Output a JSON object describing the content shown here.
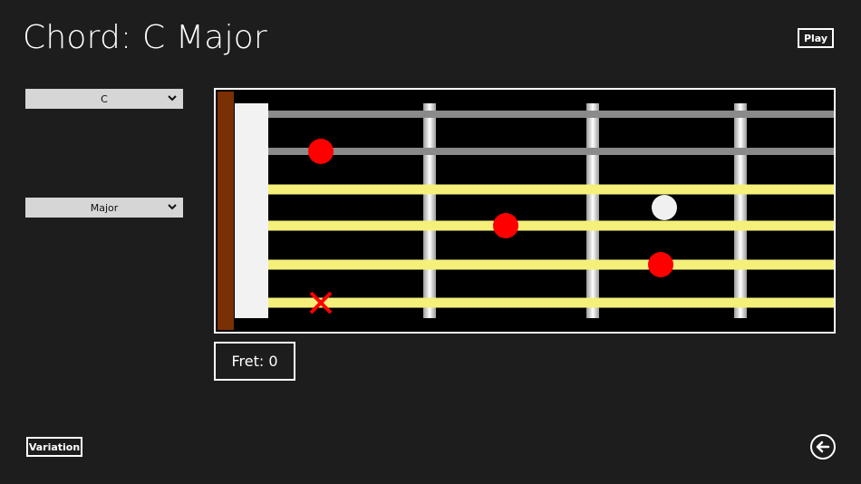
{
  "header": {
    "title": "Chord: C Major",
    "play_label": "Play"
  },
  "selectors": {
    "key": {
      "value": "C"
    },
    "type": {
      "value": "Major"
    }
  },
  "fretboard": {
    "fret_label": "Fret: 0",
    "strings": [
      {
        "index": 1,
        "color": "#8a8a8a"
      },
      {
        "index": 2,
        "color": "#8a8a8a"
      },
      {
        "index": 3,
        "color": "#f5f07a"
      },
      {
        "index": 4,
        "color": "#f5f07a"
      },
      {
        "index": 5,
        "color": "#f5f07a"
      },
      {
        "index": 6,
        "color": "#f5f07a"
      }
    ],
    "markers": [
      {
        "string": 2,
        "fret": 1,
        "type": "finger",
        "color": "#ff0000"
      },
      {
        "string": 4,
        "fret": 2,
        "type": "finger",
        "color": "#ff0000"
      },
      {
        "string": 5,
        "fret": 3,
        "type": "finger",
        "color": "#ff0000"
      },
      {
        "string": 3,
        "fret": 3,
        "type": "root",
        "color": "#f0f0f0"
      },
      {
        "string": 6,
        "fret": 1,
        "type": "muted",
        "color": "#ff0000"
      }
    ],
    "nut_color": "#f2f2f2",
    "headstock_color": "#7a2f05"
  },
  "footer": {
    "variation_label": "Variation"
  },
  "icons": {
    "back": "back-arrow-icon",
    "dropdown": "chevron-down-icon"
  }
}
